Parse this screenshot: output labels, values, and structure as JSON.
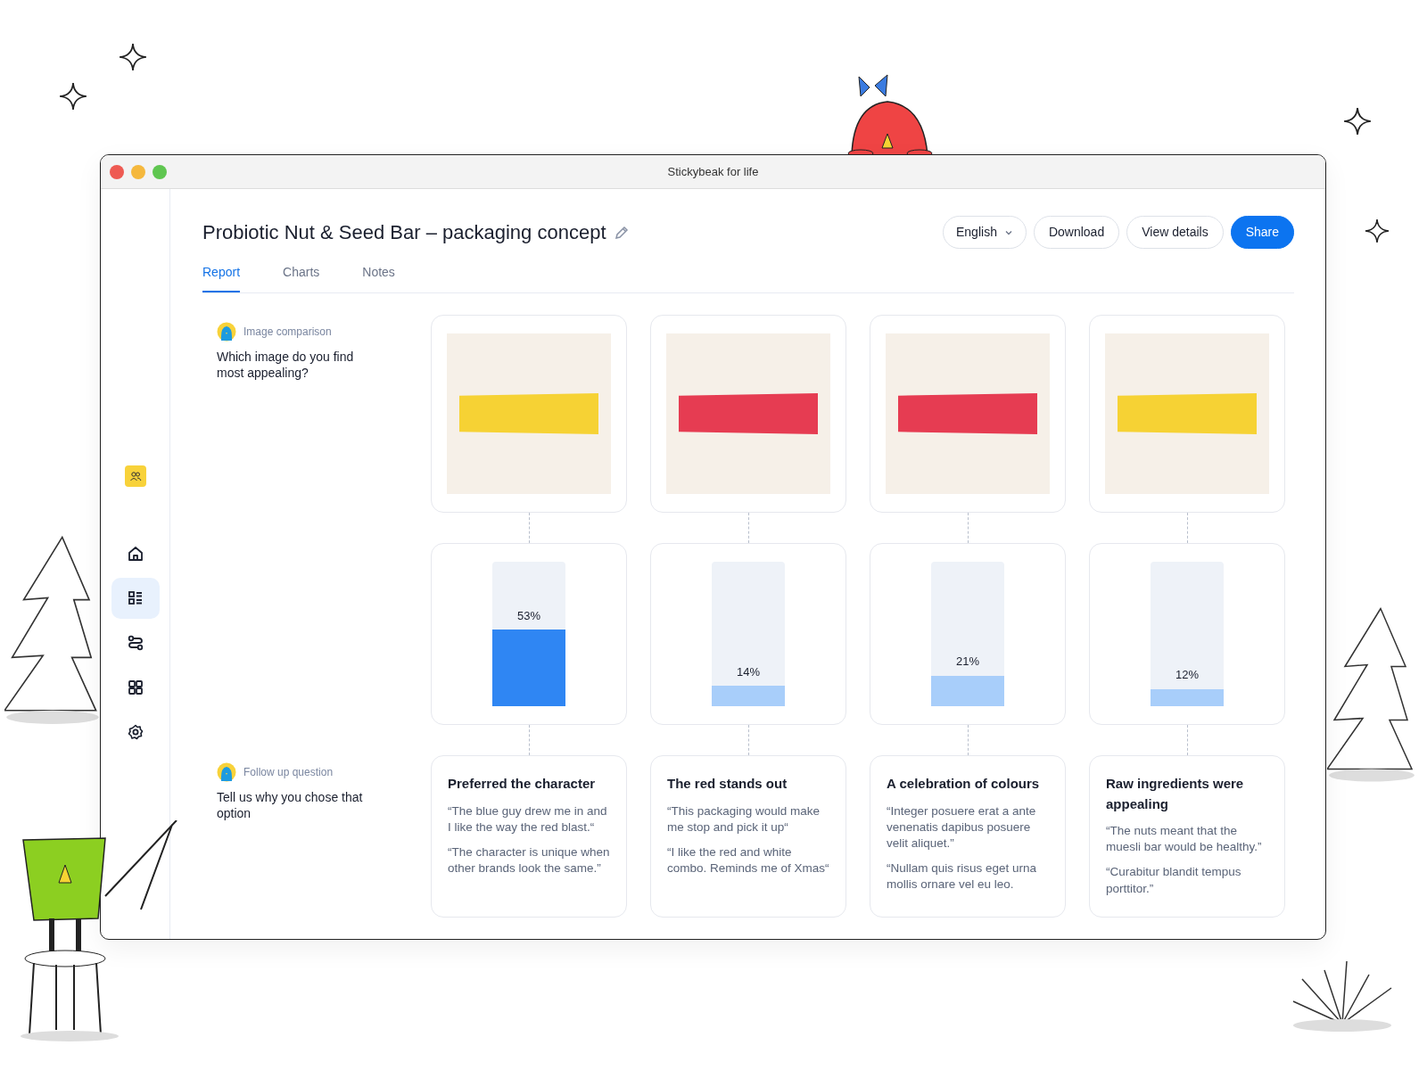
{
  "window": {
    "title": "Stickybeak for life"
  },
  "sidebar": {
    "items": [
      {
        "kind": "home",
        "selected": false
      },
      {
        "kind": "report",
        "selected": true
      },
      {
        "kind": "flow",
        "selected": false
      },
      {
        "kind": "grid",
        "selected": false
      },
      {
        "kind": "settings",
        "selected": false
      }
    ]
  },
  "header": {
    "title": "Probiotic Nut & Seed Bar – packaging concept",
    "language": "English",
    "buttons": [
      {
        "label": "Download",
        "primary": false
      },
      {
        "label": "View details",
        "primary": false
      },
      {
        "label": "Share",
        "primary": true
      }
    ]
  },
  "tabs": [
    {
      "label": "Report",
      "selected": true
    },
    {
      "label": "Charts",
      "selected": false
    },
    {
      "label": "Notes",
      "selected": false
    }
  ],
  "questions": [
    {
      "type": "Image comparison",
      "text": "Which image do you find most appealing?"
    },
    {
      "type": "Follow up question",
      "text": "Tell us why you chose that option"
    }
  ],
  "options": [
    {
      "color": "#f6d234",
      "level": 0.53,
      "reading": "53%",
      "top": true
    },
    {
      "color": "#e63c52",
      "level": 0.14,
      "reading": "14%",
      "top": false
    },
    {
      "color": "#e63c52",
      "level": 0.21,
      "reading": "21%",
      "top": false
    },
    {
      "color": "#f6d234",
      "level": 0.12,
      "reading": "12%",
      "top": false
    }
  ],
  "themes": [
    {
      "title": "Preferred the character",
      "quotes": [
        "“The blue guy drew me in and I like the way the red blast.“",
        "“The character is unique when other brands look the same.”"
      ]
    },
    {
      "title": "The red stands out",
      "quotes": [
        "“This packaging would make me stop and pick it up“",
        "“I like the red and white combo. Reminds me of Xmas“"
      ]
    },
    {
      "title": "A celebration of colours",
      "quotes": [
        "“Integer posuere erat a ante venenatis dapibus posuere velit aliquet.”",
        "“Nullam quis risus eget urna mollis ornare vel eu leo."
      ]
    },
    {
      "title": "Raw ingredients were appealing",
      "quotes": [
        "“The nuts meant that the muesli bar would be healthy.”",
        "“Curabitur blandit tempus porttitor.”"
      ]
    }
  ]
}
